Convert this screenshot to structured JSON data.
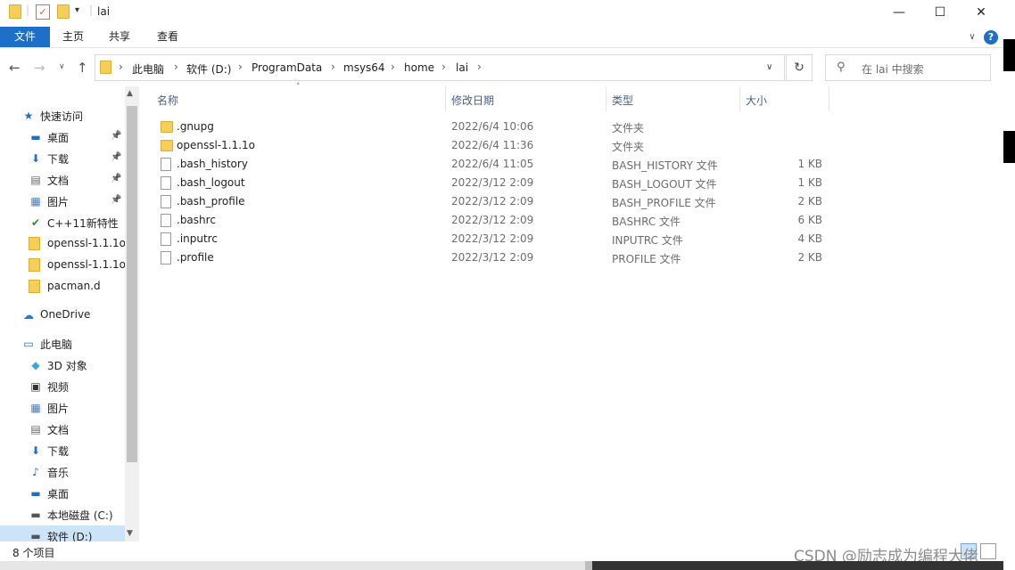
{
  "window": {
    "title": "lai",
    "minimize": "—",
    "maximize": "☐",
    "close": "✕"
  },
  "ribbon": {
    "tabs": [
      "文件",
      "主页",
      "共享",
      "查看"
    ],
    "help": "?",
    "expand": "∨"
  },
  "nav": {
    "back": "←",
    "forward": "→",
    "recent": "∨",
    "up": "↑",
    "dropdown": "∨",
    "refresh": "↻"
  },
  "address": {
    "crumbs": [
      "此电脑",
      "软件 (D:)",
      "ProgramData",
      "msys64",
      "home",
      "lai"
    ],
    "separator": "›"
  },
  "search": {
    "placeholder": "在 lai 中搜索"
  },
  "sidebar": {
    "items": [
      {
        "label": "快速访问",
        "icon": "star-icon",
        "level": 0
      },
      {
        "label": "桌面",
        "icon": "desktop-icon",
        "level": 1,
        "pinned": true
      },
      {
        "label": "下载",
        "icon": "download-icon",
        "level": 1,
        "pinned": true
      },
      {
        "label": "文档",
        "icon": "document-icon",
        "level": 1,
        "pinned": true
      },
      {
        "label": "图片",
        "icon": "pictures-icon",
        "level": 1,
        "pinned": true
      },
      {
        "label": "C++11新特性",
        "icon": "folder-check-icon",
        "level": 1
      },
      {
        "label": "openssl-1.1.1o",
        "icon": "folder-icon",
        "level": 1
      },
      {
        "label": "openssl-1.1.1o",
        "icon": "folder-icon",
        "level": 1
      },
      {
        "label": "pacman.d",
        "icon": "folder-icon",
        "level": 1
      },
      {
        "label": "OneDrive",
        "icon": "cloud-icon",
        "level": 0
      },
      {
        "label": "此电脑",
        "icon": "computer-icon",
        "level": 0
      },
      {
        "label": "3D 对象",
        "icon": "cube-icon",
        "level": 1
      },
      {
        "label": "视频",
        "icon": "video-icon",
        "level": 1
      },
      {
        "label": "图片",
        "icon": "pictures-icon",
        "level": 1
      },
      {
        "label": "文档",
        "icon": "document-icon",
        "level": 1
      },
      {
        "label": "下载",
        "icon": "download-icon",
        "level": 1
      },
      {
        "label": "音乐",
        "icon": "music-icon",
        "level": 1
      },
      {
        "label": "桌面",
        "icon": "desktop-icon",
        "level": 1
      },
      {
        "label": "本地磁盘 (C:)",
        "icon": "drive-icon",
        "level": 1
      },
      {
        "label": "软件 (D:)",
        "icon": "drive-icon",
        "level": 1,
        "selected": true
      }
    ]
  },
  "columns": {
    "name": "名称",
    "date": "修改日期",
    "type": "类型",
    "size": "大小",
    "sort_indicator": "˄"
  },
  "files": [
    {
      "name": ".gnupg",
      "date": "2022/6/4 10:06",
      "type": "文件夹",
      "size": "",
      "kind": "folder"
    },
    {
      "name": "openssl-1.1.1o",
      "date": "2022/6/4 11:36",
      "type": "文件夹",
      "size": "",
      "kind": "folder"
    },
    {
      "name": ".bash_history",
      "date": "2022/6/4 11:05",
      "type": "BASH_HISTORY 文件",
      "size": "1 KB",
      "kind": "file"
    },
    {
      "name": ".bash_logout",
      "date": "2022/3/12 2:09",
      "type": "BASH_LOGOUT 文件",
      "size": "1 KB",
      "kind": "file"
    },
    {
      "name": ".bash_profile",
      "date": "2022/3/12 2:09",
      "type": "BASH_PROFILE 文件",
      "size": "2 KB",
      "kind": "file"
    },
    {
      "name": ".bashrc",
      "date": "2022/3/12 2:09",
      "type": "BASHRC 文件",
      "size": "6 KB",
      "kind": "file"
    },
    {
      "name": ".inputrc",
      "date": "2022/3/12 2:09",
      "type": "INPUTRC 文件",
      "size": "4 KB",
      "kind": "file"
    },
    {
      "name": ".profile",
      "date": "2022/3/12 2:09",
      "type": "PROFILE 文件",
      "size": "2 KB",
      "kind": "file"
    }
  ],
  "status": {
    "count": "8 个项目"
  },
  "watermark": "CSDN @励志成为编程大佬",
  "colors": {
    "accent": "#1e6fc7",
    "selection": "#cce4f7",
    "folder": "#f5cf5a"
  }
}
